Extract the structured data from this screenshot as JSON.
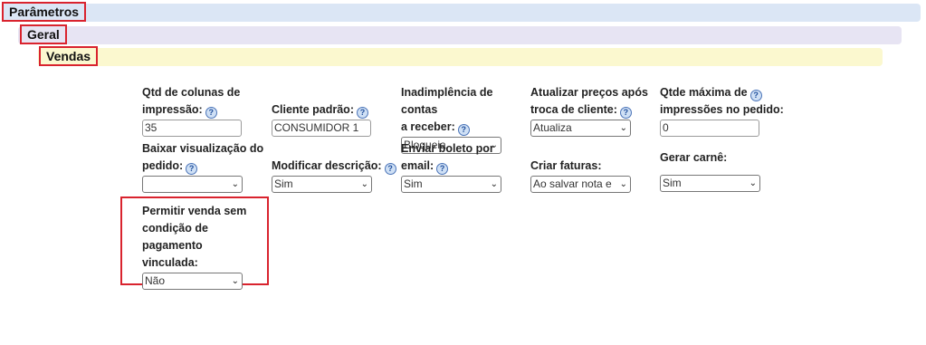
{
  "sections": {
    "parametros": "Parâmetros",
    "geral": "Geral",
    "vendas": "Vendas"
  },
  "fields": {
    "qtd_colunas": {
      "label_l1": "Qtd de colunas de",
      "label_l2": "impressão:",
      "value": "35",
      "help_icon": "question-icon"
    },
    "cliente_padrao": {
      "label": "Cliente padrão:",
      "value": "CONSUMIDOR 1",
      "help_icon": "question-icon"
    },
    "inadimplencia": {
      "label_l1": "Inadimplência de contas",
      "label_l2": "a receber:",
      "value": "Bloqueia",
      "help_icon": "question-icon"
    },
    "atualizar_precos": {
      "label_l1": "Atualizar preços após",
      "label_l2": "troca de cliente:",
      "value": "Atualiza",
      "help_icon": "question-icon"
    },
    "qtde_maxima": {
      "label_l1": "Qtde máxima de",
      "label_l2": "impressões no pedido:",
      "value": "0",
      "help_icon": "question-icon"
    },
    "baixar_visualizacao": {
      "label_l1": "Baixar visualização do",
      "label_l2": "pedido:",
      "value": "",
      "help_icon": "question-icon"
    },
    "modificar_descricao": {
      "label": "Modificar descrição:",
      "value": "Sim",
      "help_icon": "question-icon"
    },
    "enviar_boleto": {
      "label_l1": "Enviar boleto por",
      "label_l2": "email:",
      "value": "Sim",
      "help_icon": "question-icon"
    },
    "criar_faturas": {
      "label": "Criar faturas:",
      "value": "Ao salvar nota e o"
    },
    "gerar_carne": {
      "label": "Gerar carnê:",
      "value": "Sim"
    },
    "permitir_venda": {
      "label_l1": "Permitir venda sem",
      "label_l2": "condição de pagamento",
      "label_l3": "vinculada:",
      "value": "Não"
    }
  },
  "icons": {
    "dropdown": "chevron-down-icon"
  },
  "colors": {
    "highlight": "#d9232e",
    "help_icon": "#4b74b8"
  }
}
